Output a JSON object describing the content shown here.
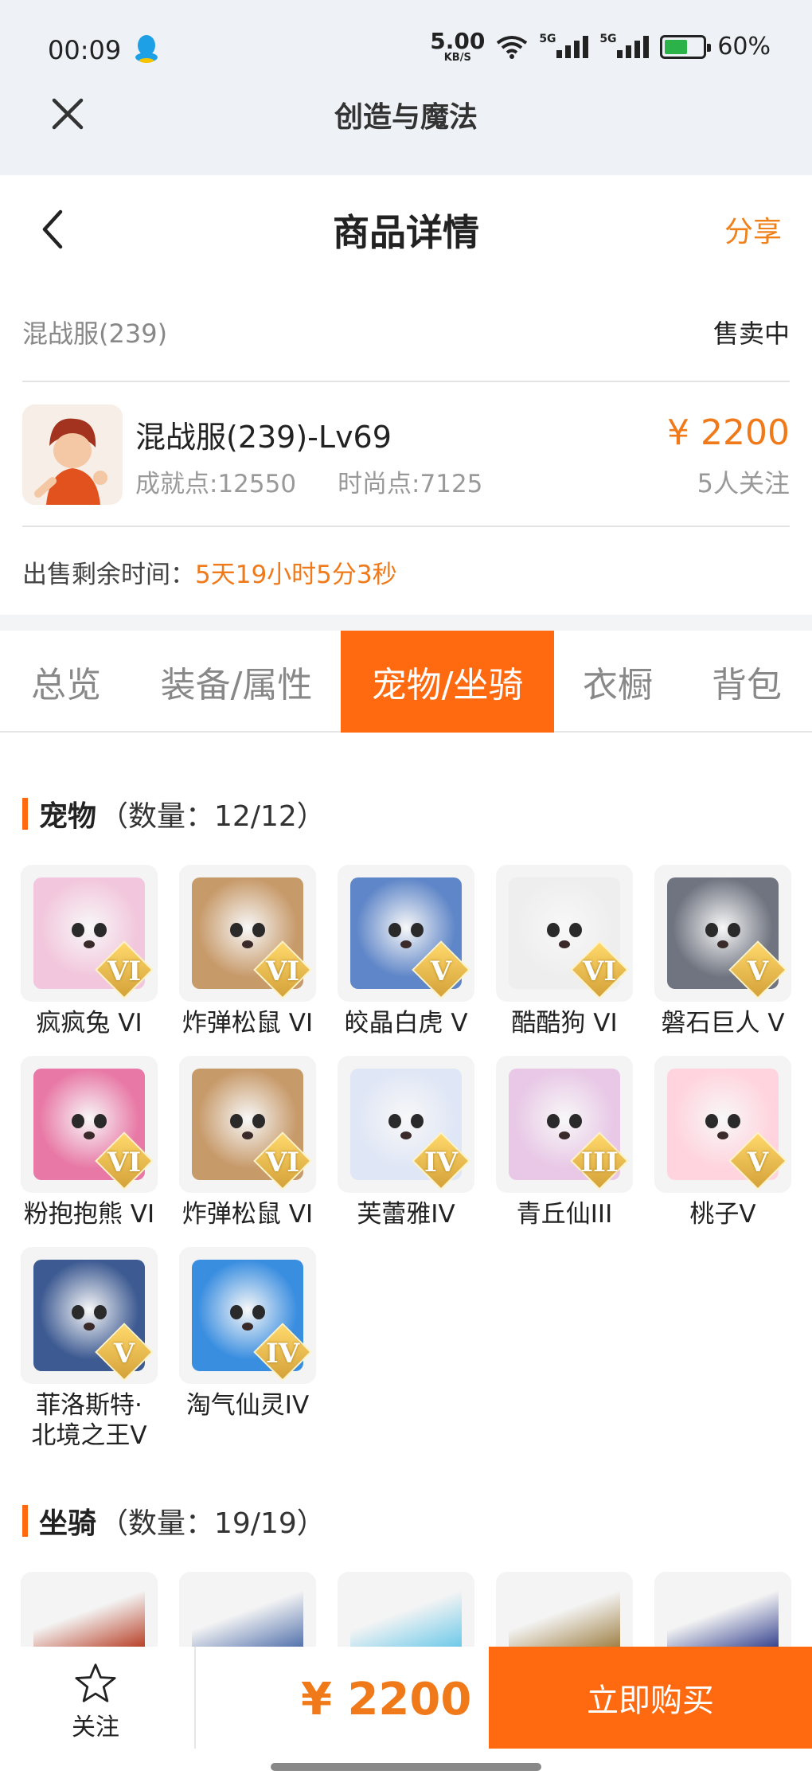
{
  "status_bar": {
    "time": "00:09",
    "net_speed": "5.00",
    "net_unit": "KB/S",
    "signal1_tag": "5G",
    "signal2_tag": "5G",
    "battery": "60%",
    "battery_level": 0.6
  },
  "app_bar": {
    "title": "创造与魔法"
  },
  "header": {
    "title": "商品详情",
    "share": "分享"
  },
  "server": {
    "name": "混战服(239)",
    "status": "售卖中"
  },
  "item": {
    "name": "混战服(239)-Lv69",
    "achievement": "成就点:12550",
    "fashion": "时尚点:7125",
    "price": "¥ 2200",
    "watchers": "5人关注"
  },
  "remaining": {
    "label": "出售剩余时间：",
    "value": "5天19小时5分3秒"
  },
  "tabs": [
    {
      "label": "总览",
      "active": false
    },
    {
      "label": "装备/属性",
      "active": false
    },
    {
      "label": "宠物/坐骑",
      "active": true
    },
    {
      "label": "衣橱",
      "active": false
    },
    {
      "label": "背包",
      "active": false
    }
  ],
  "pets_section": {
    "title": "宠物",
    "count": "（数量：12/12）"
  },
  "pets": [
    {
      "name": "疯疯兔 VI",
      "roman": "VI",
      "color": "#f2c6dc"
    },
    {
      "name": "炸弹松鼠 VI",
      "roman": "VI",
      "color": "#c79a6a"
    },
    {
      "name": "皎晶白虎 V",
      "roman": "V",
      "color": "#5f86c8"
    },
    {
      "name": "酷酷狗 VI",
      "roman": "VI",
      "color": "#eeeeee"
    },
    {
      "name": "磐石巨人 V",
      "roman": "V",
      "color": "#6f7480"
    },
    {
      "name": "粉抱抱熊 VI",
      "roman": "VI",
      "color": "#e879a6"
    },
    {
      "name": "炸弹松鼠 VI",
      "roman": "VI",
      "color": "#c79a6a"
    },
    {
      "name": "芙蕾雅IV",
      "roman": "IV",
      "color": "#dfe6f5"
    },
    {
      "name": "青丘仙III",
      "roman": "III",
      "color": "#e8c8e6"
    },
    {
      "name": "桃子V",
      "roman": "V",
      "color": "#ffd4de"
    },
    {
      "name": "菲洛斯特·北境之王V",
      "name_line1": "菲洛斯特·",
      "name_line2": "北境之王V",
      "roman": "V",
      "color": "#3d5a92"
    },
    {
      "name": "淘气仙灵IV",
      "roman": "IV",
      "color": "#3a8ee0"
    }
  ],
  "mounts_section": {
    "title": "坐骑",
    "count": "（数量：19/19）"
  },
  "mounts": [
    {
      "color": "#b4361c"
    },
    {
      "color": "#4a6aa8"
    },
    {
      "color": "#64c6e8"
    },
    {
      "color": "#9a7a3c"
    },
    {
      "color": "#2c3a8a"
    }
  ],
  "bottom": {
    "follow": "关注",
    "price": "¥ 2200",
    "buy": "立即购买"
  }
}
